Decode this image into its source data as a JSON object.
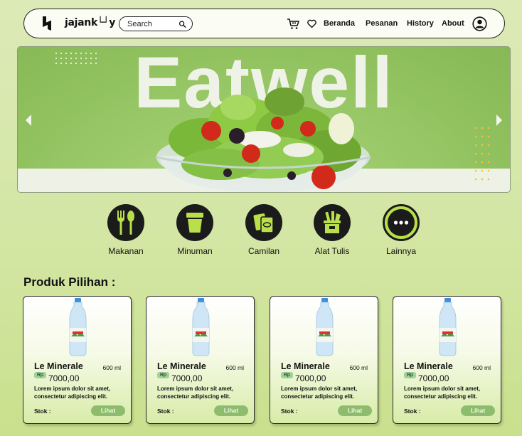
{
  "nav": {
    "brand": "jajank└┘y",
    "search_placeholder": "Search",
    "links": [
      "Beranda",
      "Pesanan",
      "History",
      "About"
    ]
  },
  "banner": {
    "title": "Eatwell"
  },
  "categories": [
    {
      "label": "Makanan",
      "icon": "utensils-icon"
    },
    {
      "label": "Minuman",
      "icon": "cup-icon"
    },
    {
      "label": "Camilan",
      "icon": "snack-icon"
    },
    {
      "label": "Alat Tulis",
      "icon": "stationery-icon"
    },
    {
      "label": "Lainnya",
      "icon": "more-icon"
    }
  ],
  "section_title": "Produk Pilihan :",
  "products": [
    {
      "name": "Le Minerale",
      "volume": "600 ml",
      "currency": "Rp",
      "price": "7000,00",
      "desc": "Lorem ipsum dolor sit amet, consectetur adipiscing elit.",
      "stock_label": "Stok :",
      "button": "Lihat"
    },
    {
      "name": "Le Minerale",
      "volume": "600 ml",
      "currency": "Rp",
      "price": "7000,00",
      "desc": "Lorem ipsum dolor sit amet, consectetur adipiscing elit.",
      "stock_label": "Stok :",
      "button": "Lihat"
    },
    {
      "name": "Le Minerale",
      "volume": "600 ml",
      "currency": "Rp",
      "price": "7000,00",
      "desc": "Lorem ipsum dolor sit amet, consectetur adipiscing elit.",
      "stock_label": "Stok :",
      "button": "Lihat"
    },
    {
      "name": "Le Minerale",
      "volume": "600 ml",
      "currency": "Rp",
      "price": "7000,00",
      "desc": "Lorem ipsum dolor sit amet, consectetur adipiscing elit.",
      "stock_label": "Stok :",
      "button": "Lihat"
    }
  ],
  "colors": {
    "accent": "#8cbc6c",
    "background": "#d3e6a4",
    "icon_bg": "#1b1b1b",
    "icon_fg": "#b9e04a"
  }
}
